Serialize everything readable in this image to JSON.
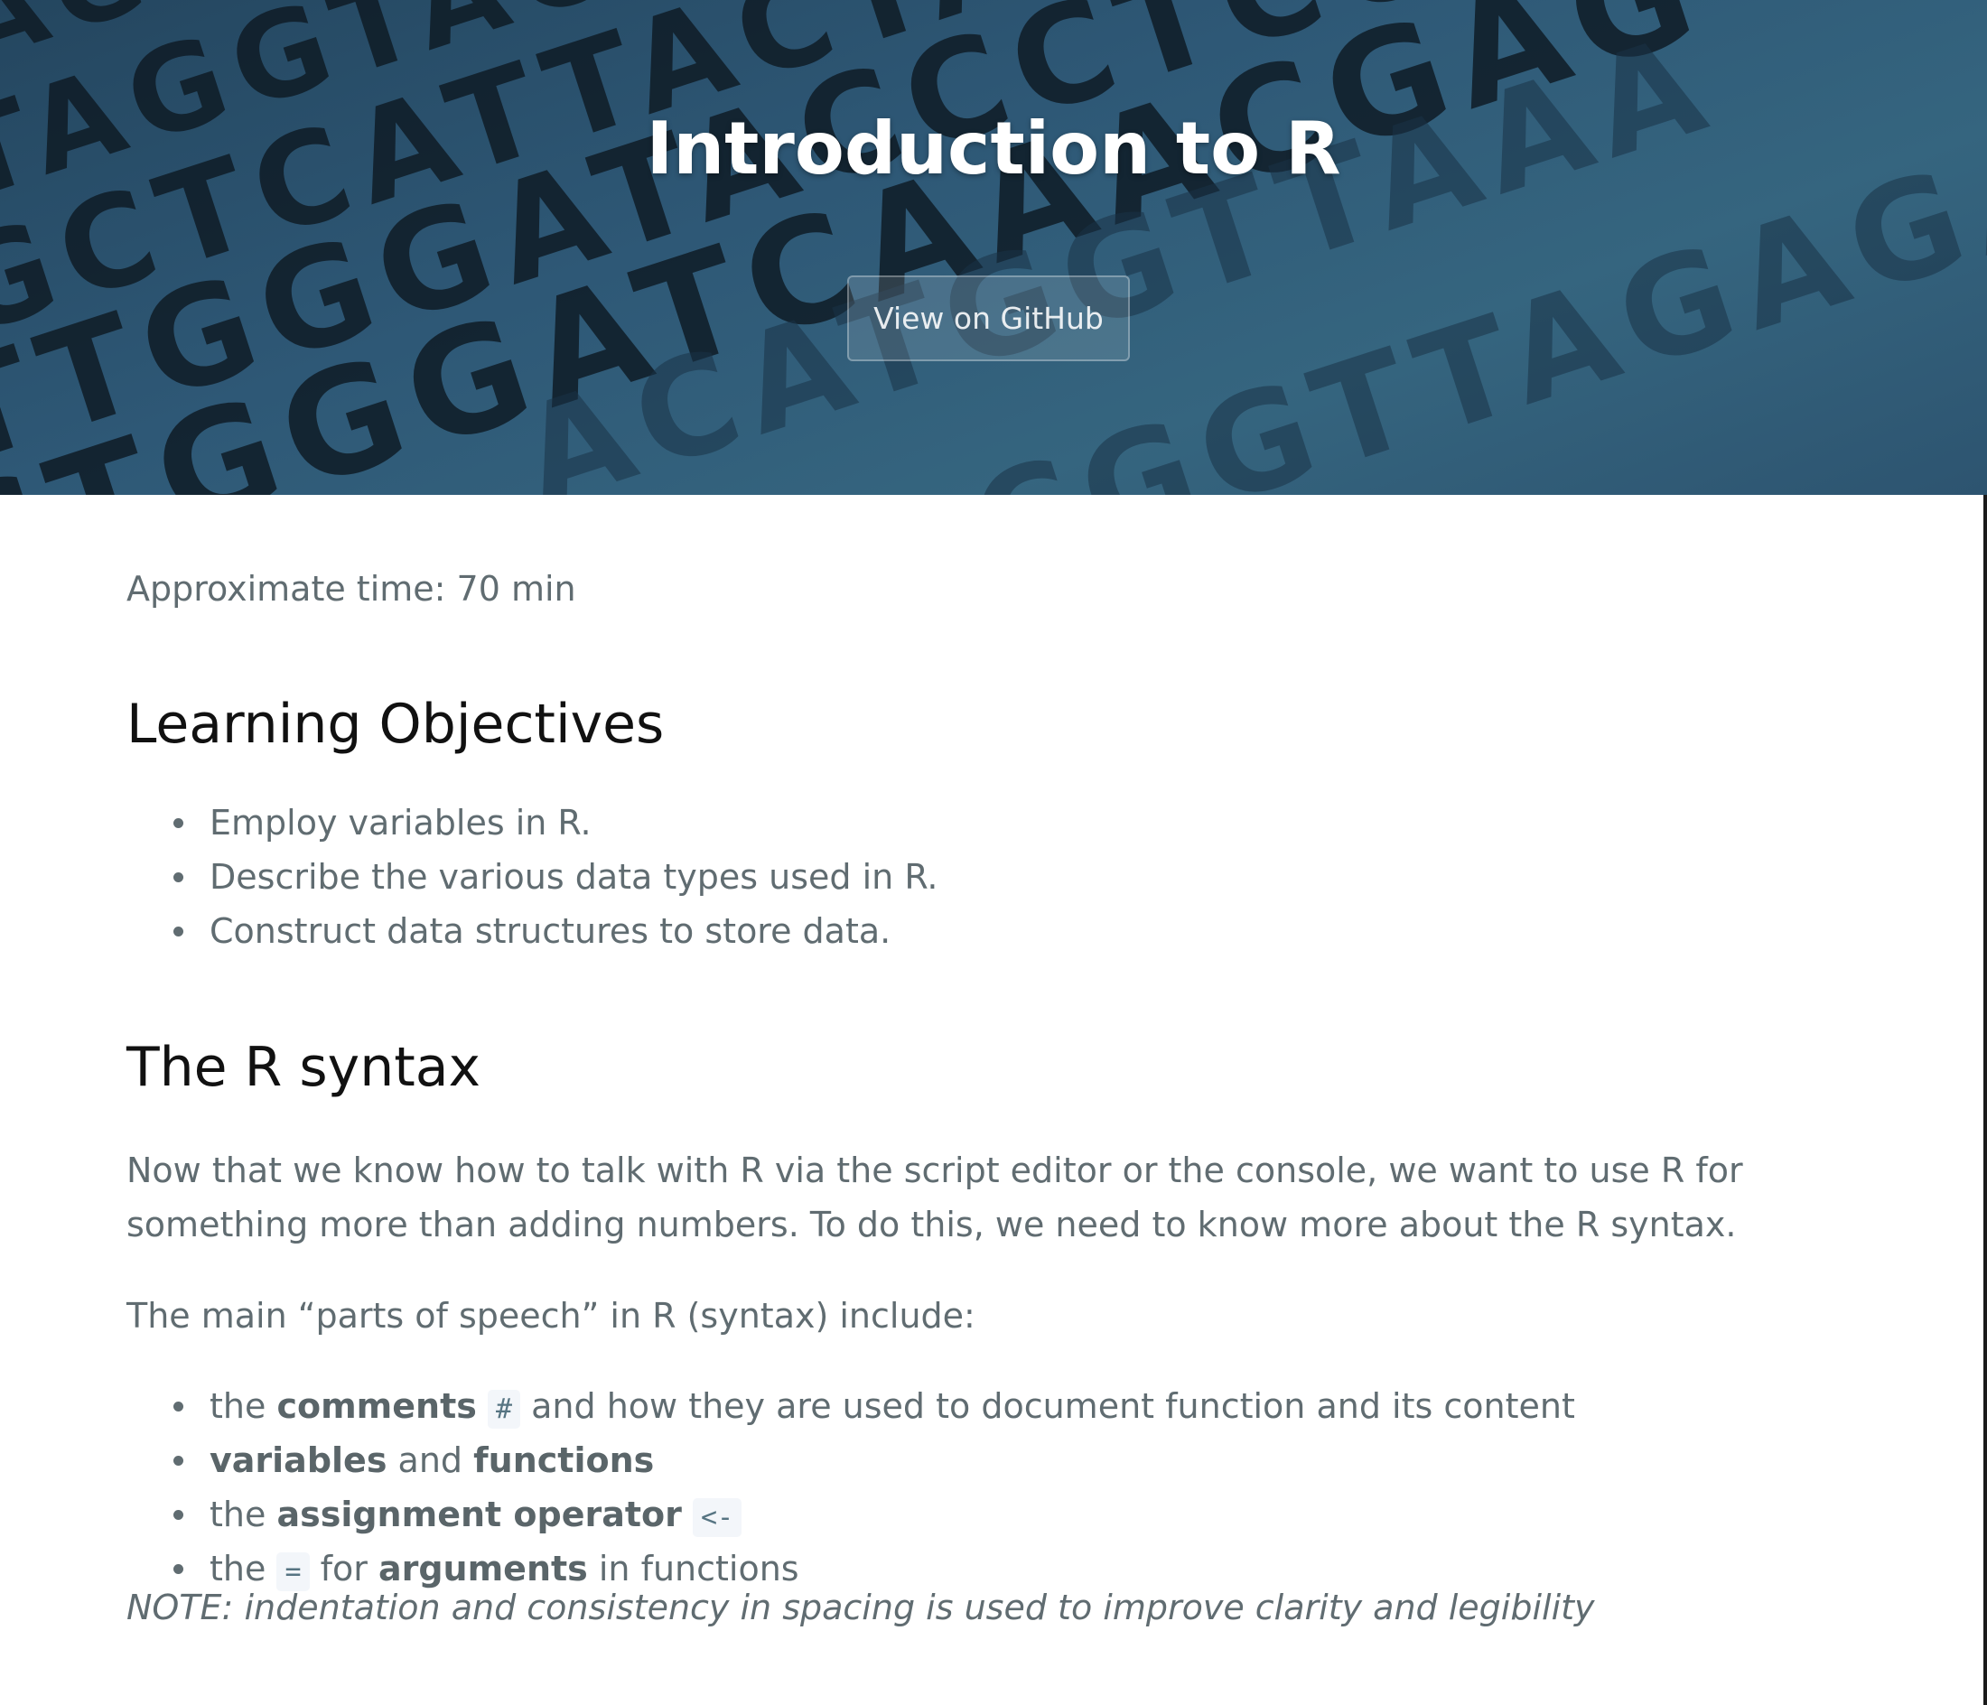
{
  "header": {
    "title": "Introduction to R",
    "github_button": "View on GitHub"
  },
  "main": {
    "time": "Approximate time: 70 min",
    "objectives": {
      "heading": "Learning Objectives",
      "items": [
        "Employ variables in R.",
        "Describe the various data types used in R.",
        "Construct data structures to store data."
      ]
    },
    "syntax": {
      "heading": "The R syntax",
      "intro_line1": "Now that we know how to talk with R via the script editor or the console, we want to use R for",
      "intro_line2": "something more than adding numbers. To do this, we need to know more about the R syntax.",
      "parts_intro": "The main “parts of speech” in R (syntax) include:",
      "parts": [
        {
          "pre": "the ",
          "bold": "comments",
          "code": "#",
          "post": " and how they are used to document function and its content"
        },
        {
          "bold1": "variables",
          "mid": " and ",
          "bold2": "functions"
        },
        {
          "pre": "the ",
          "bold": "assignment operator",
          "code": "<-"
        },
        {
          "pre": "the ",
          "code": "=",
          "mid": " for ",
          "bold": "arguments",
          "post": " in functions"
        }
      ],
      "note": "NOTE: indentation and consistency in spacing is used to improve clarity and legibility"
    }
  },
  "colors": {
    "header_bg": "#2e5876",
    "body_text": "#606c71",
    "heading_text": "#111111"
  }
}
